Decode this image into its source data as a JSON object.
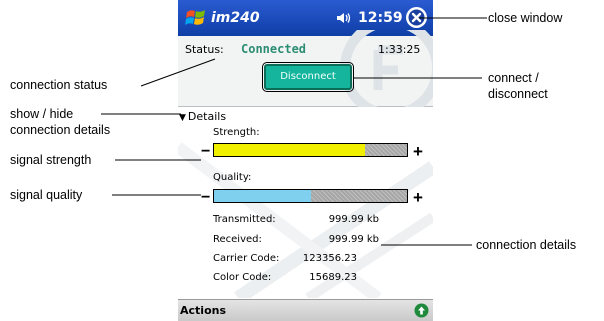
{
  "window": {
    "title": "im240",
    "clock": "12:59"
  },
  "connection": {
    "status_label": "Status:",
    "status_value": "Connected",
    "elapsed": "1:33:25",
    "disconnect_label": "Disconnect"
  },
  "details": {
    "toggle_label": "Details",
    "strength_label": "Strength:",
    "strength_level": 0.78,
    "quality_label": "Quality:",
    "quality_level": 0.5,
    "minus": "−",
    "plus": "+",
    "stats": [
      {
        "label": "Transmitted:",
        "value": "999.99 kb"
      },
      {
        "label": "Received:",
        "value": "999.99 kb"
      },
      {
        "label": "Carrier Code:",
        "value": "123356.23"
      },
      {
        "label": "Color Code:",
        "value": "15689.23"
      }
    ]
  },
  "menu": {
    "actions_label": "Actions"
  },
  "annotations": {
    "close_window": "close window",
    "connection_status": "connection status",
    "connect_disconnect_1": "connect /",
    "connect_disconnect_2": "disconnect",
    "show_hide_1": "show / hide",
    "show_hide_2": "connection details",
    "signal_strength": "signal strength",
    "signal_quality": "signal quality",
    "connection_details": "connection details"
  },
  "colors": {
    "titlebar": "#1a4bbd",
    "status_connected": "#2c8d72",
    "button": "#15b49c",
    "strength_fill": "#f0f000",
    "quality_fill": "#7fcfee"
  },
  "icons": [
    "windows-flag-icon",
    "speaker-icon",
    "close-icon",
    "up-arrow-icon"
  ]
}
